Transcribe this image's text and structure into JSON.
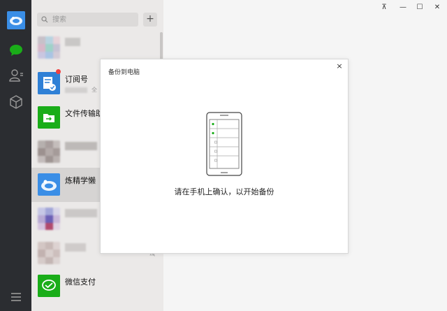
{
  "search": {
    "placeholder": "搜索"
  },
  "add_button": {
    "label": "+"
  },
  "sessions": [
    {
      "title": "",
      "subtitle": ""
    },
    {
      "title": "订阅号",
      "subtitle": "全"
    },
    {
      "title": "文件传输助",
      "subtitle": ""
    },
    {
      "title": "",
      "subtitle": ""
    },
    {
      "title": "炼精学懒",
      "subtitle": ""
    },
    {
      "title": "",
      "subtitle": ""
    },
    {
      "title": "",
      "subtitle": ""
    },
    {
      "title": "微信支付",
      "subtitle": ""
    }
  ],
  "window_controls": {
    "pin": "⊼",
    "minimize": "—",
    "maximize": "☐",
    "close": "✕"
  },
  "dialog": {
    "title": "备份到电脑",
    "close": "×",
    "message": "请在手机上确认，以开始备份"
  },
  "colors": {
    "accent_green": "#1aad19",
    "rail_bg": "#2b2d31",
    "list_bg": "#ebe9e8",
    "selected_bg": "#d6d4d3",
    "badge_red": "#f04040"
  }
}
